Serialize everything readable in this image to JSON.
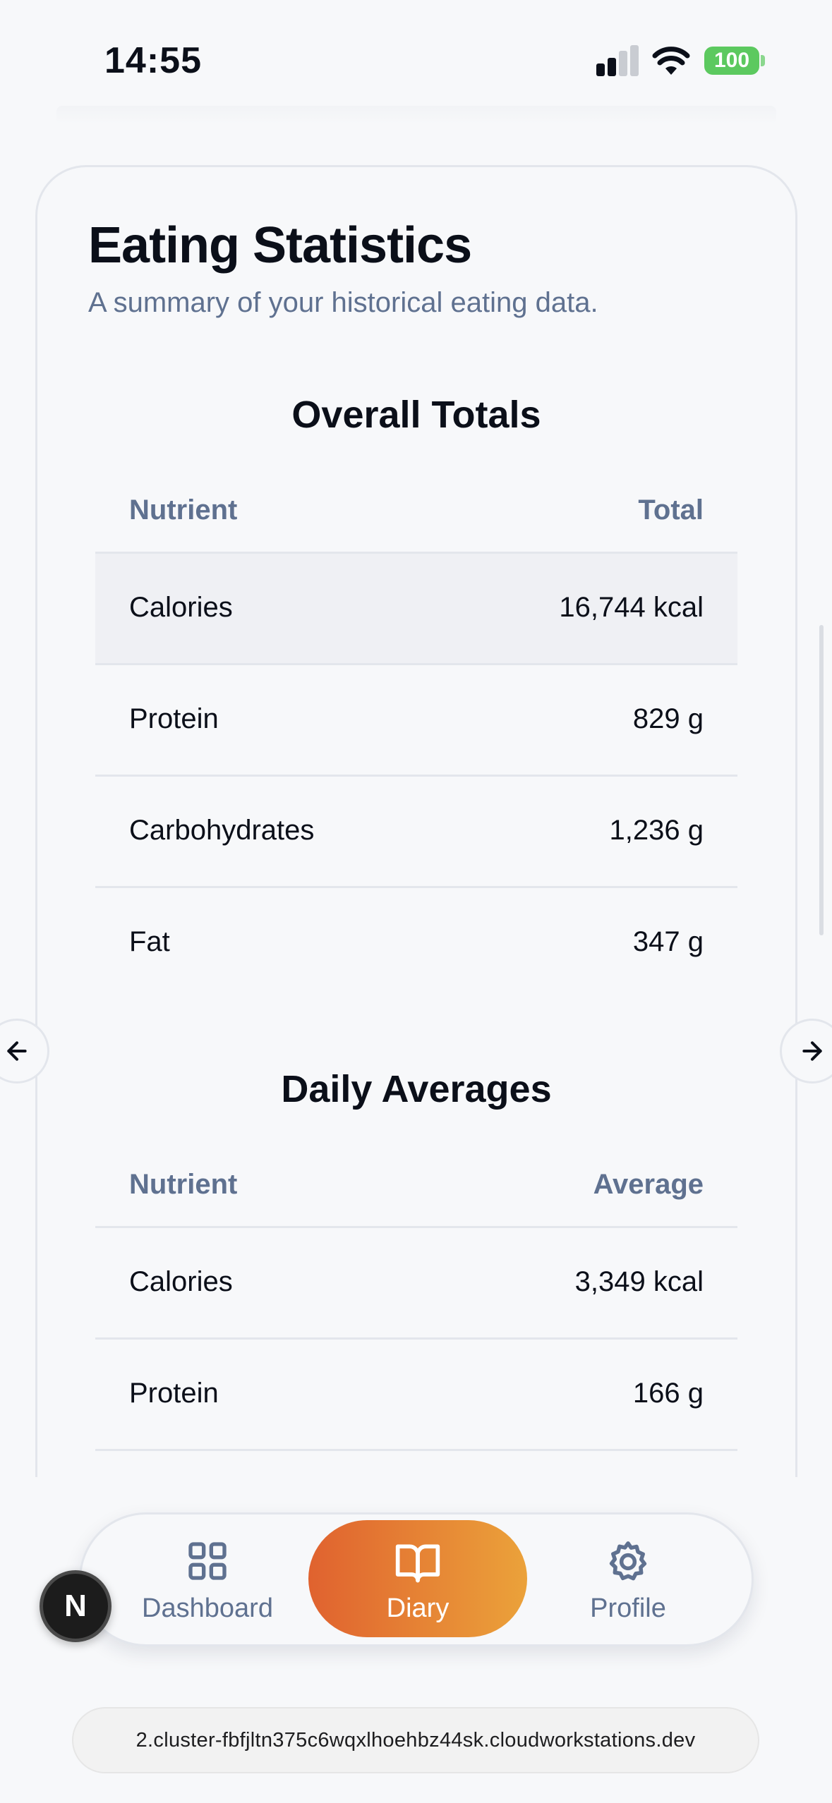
{
  "status_bar": {
    "time": "14:55",
    "battery": "100",
    "battery_color": "#5cc95f"
  },
  "card": {
    "title": "Eating Statistics",
    "subtitle": "A summary of your historical eating data."
  },
  "overall_totals": {
    "title": "Overall Totals",
    "headers": [
      "Nutrient",
      "Total"
    ],
    "rows": [
      {
        "nutrient": "Calories",
        "value": "16,744 kcal"
      },
      {
        "nutrient": "Protein",
        "value": "829 g"
      },
      {
        "nutrient": "Carbohydrates",
        "value": "1,236 g"
      },
      {
        "nutrient": "Fat",
        "value": "347 g"
      }
    ]
  },
  "daily_averages": {
    "title": "Daily Averages",
    "headers": [
      "Nutrient",
      "Average"
    ],
    "rows": [
      {
        "nutrient": "Calories",
        "value": "3,349 kcal"
      },
      {
        "nutrient": "Protein",
        "value": "166 g"
      }
    ]
  },
  "navigation": {
    "items": [
      {
        "label": "Dashboard",
        "icon": "grid-icon",
        "active": false
      },
      {
        "label": "Diary",
        "icon": "book-icon",
        "active": true
      },
      {
        "label": "Profile",
        "icon": "gear-icon",
        "active": false
      }
    ],
    "active_gradient": [
      "#e0622f",
      "#eba23a"
    ]
  },
  "dev_badge": "N",
  "url": "2.cluster-fbfjltn375c6wqxlhoehbz44sk.cloudworkstations.dev"
}
